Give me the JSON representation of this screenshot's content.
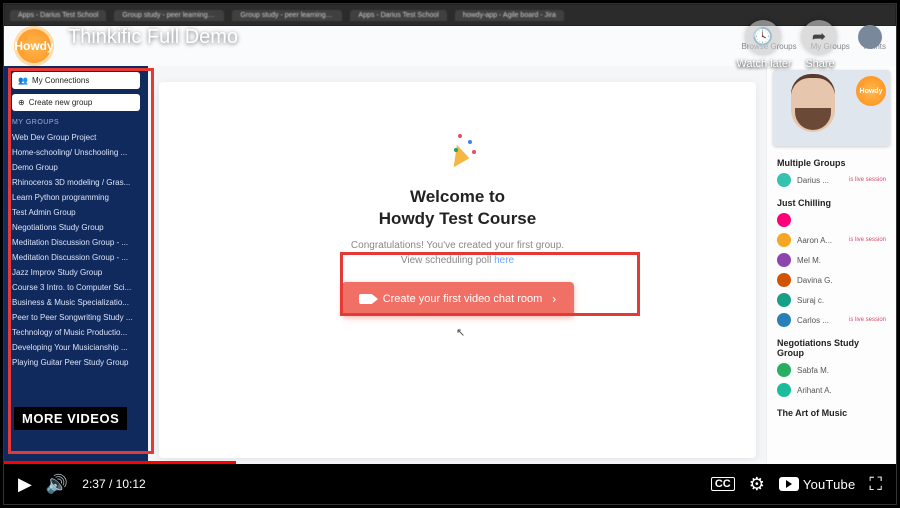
{
  "browser": {
    "tabs": [
      "Apps - Darius Test School",
      "Group study - peer learning - yo...",
      "Group study - peer learning - yo...",
      "Apps - Darius Test School",
      "howdy-app - Agile board - Jira"
    ]
  },
  "app": {
    "logo_text": "Howdy",
    "header_links": [
      "Browse Groups",
      "My Groups",
      "Points"
    ]
  },
  "sidebar": {
    "my_connections": "My Connections",
    "create_group": "Create new group",
    "groups_heading": "MY GROUPS",
    "items": [
      "Web Dev Group Project",
      "Home-schooling/ Unschooling ...",
      "Demo Group",
      "Rhinoceros 3D modeling / Gras...",
      "Learn Python programming",
      "Test Admin Group",
      "Negotiations Study Group",
      "Meditation Discussion Group - ...",
      "Meditation Discussion Group - ...",
      "Jazz Improv Study Group",
      "Course 3 Intro. to Computer Sci...",
      "Business & Music Specializatio...",
      "Peer to Peer Songwriting Study ...",
      "Technology of Music Productio...",
      "Developing Your Musicianship ...",
      "Playing Guitar Peer Study Group"
    ],
    "more_videos_overlay": "MORE VIDEOS"
  },
  "main": {
    "welcome_line1": "Welcome to",
    "welcome_line2": "Howdy Test Course",
    "congrats": "Congratulations! You've created your first group.",
    "poll_text": "View scheduling poll ",
    "poll_link": "here",
    "cta_label": "Create your first video chat room"
  },
  "right": {
    "pip_label": "Howdy",
    "sections": [
      {
        "title": "Multiple Groups",
        "members": [
          {
            "name": "Darius ...",
            "live": "is live session"
          }
        ]
      },
      {
        "title": "Just Chilling",
        "members": [
          {
            "name": "",
            "live": ""
          },
          {
            "name": "Aaron A...",
            "live": "is live session"
          },
          {
            "name": "Mel M.",
            "live": ""
          },
          {
            "name": "Davina G.",
            "live": ""
          },
          {
            "name": "Suraj c.",
            "live": ""
          },
          {
            "name": "Carlos ...",
            "live": "is live session"
          }
        ]
      },
      {
        "title": "Negotiations Study Group",
        "members": [
          {
            "name": "Sabfa M.",
            "live": ""
          },
          {
            "name": "Arihant A.",
            "live": ""
          }
        ]
      },
      {
        "title": "The Art of Music",
        "members": []
      }
    ]
  },
  "youtube": {
    "title": "Thinkific Full Demo",
    "watch_later": "Watch later",
    "share": "Share",
    "time_current": "2:37",
    "time_total": "10:12",
    "brand": "YouTube",
    "cc": "CC"
  }
}
